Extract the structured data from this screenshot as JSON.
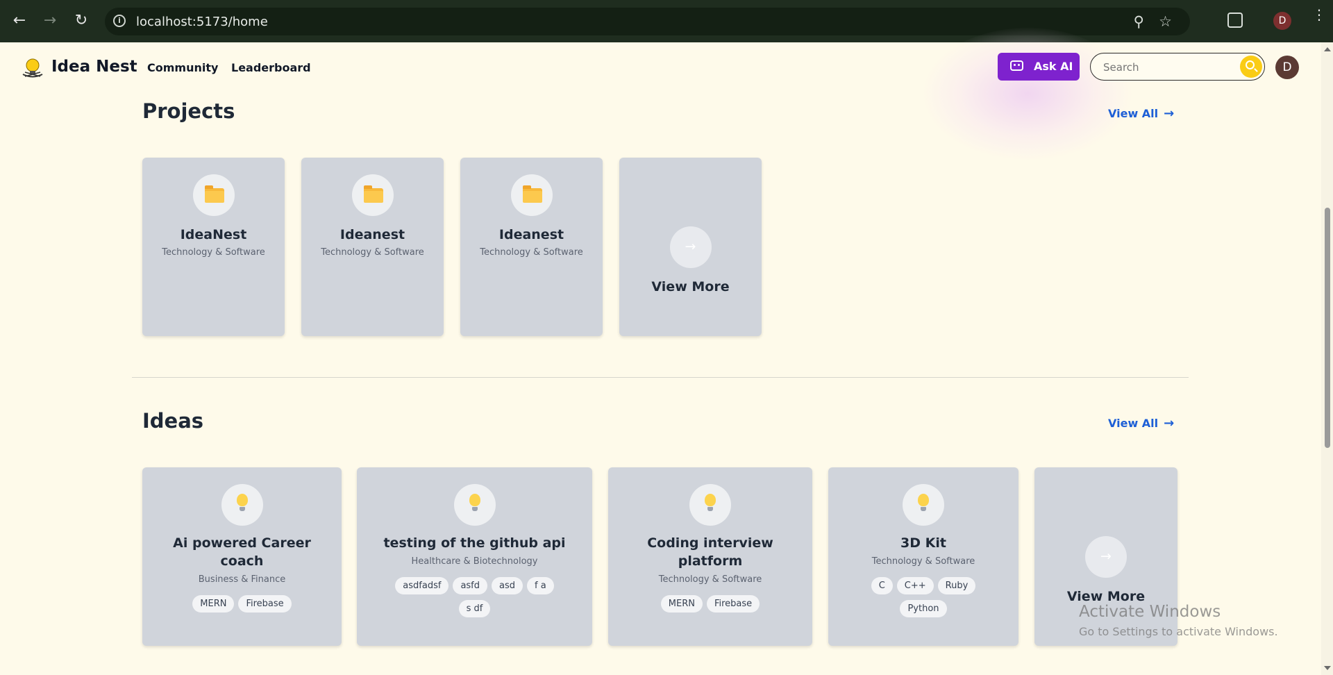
{
  "browser": {
    "url": "localhost:5173/home",
    "profile_initial": "D"
  },
  "header": {
    "logo_text": "Idea Nest",
    "nav": [
      "Community",
      "Leaderboard"
    ],
    "ask_ai_label": "Ask AI",
    "search_placeholder": "Search",
    "avatar_initial": "D"
  },
  "projects": {
    "title": "Projects",
    "view_all": "View All",
    "items": [
      {
        "title": "IdeaNest",
        "category": "Technology & Software"
      },
      {
        "title": "Ideanest",
        "category": "Technology & Software"
      },
      {
        "title": "Ideanest",
        "category": "Technology & Software"
      }
    ],
    "view_more": "View More"
  },
  "ideas": {
    "title": "Ideas",
    "view_all": "View All",
    "items": [
      {
        "title": "Ai powered Career coach",
        "category": "Business & Finance",
        "tags": [
          "MERN",
          "Firebase"
        ]
      },
      {
        "title": "testing of the github api",
        "category": "Healthcare & Biotechnology",
        "tags": [
          "asdfadsf",
          "asfd",
          "asd",
          "f a",
          "s df"
        ]
      },
      {
        "title": "Coding interview platform",
        "category": "Technology & Software",
        "tags": [
          "MERN",
          "Firebase"
        ]
      },
      {
        "title": "3D Kit",
        "category": "Technology & Software",
        "tags": [
          "C",
          "C++",
          "Ruby",
          "Python"
        ]
      }
    ],
    "view_more": "View More"
  },
  "watermark": {
    "line1": "Activate Windows",
    "line2": "Go to Settings to activate Windows."
  },
  "colors": {
    "page_bg": "#fefaea",
    "accent_purple": "#7e22ce",
    "search_yellow": "#facc15",
    "link_blue": "#1d5fd6",
    "card_bg": "#d0d4db"
  }
}
